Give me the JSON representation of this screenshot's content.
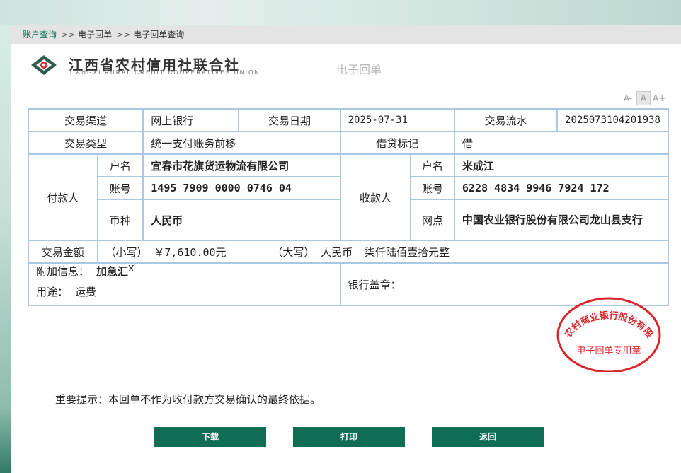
{
  "breadcrumb": [
    "账户查询",
    "电子回单",
    "电子回单查询"
  ],
  "bank": {
    "name_cn": "江西省农村信用社联合社",
    "name_en": "JIANGXI RURAL CREDIT COOPERATIVES UNION"
  },
  "doc_title": "电子回单",
  "font_controls": [
    "A-",
    "A",
    "A+"
  ],
  "receipt": {
    "channel_label": "交易渠道",
    "channel": "网上银行",
    "date_label": "交易日期",
    "date": "2025-07-31",
    "serial_label": "交易流水",
    "serial": "2025073104201938",
    "type_label": "交易类型",
    "type": "统一支付账务前移",
    "dc_label": "借贷标记",
    "dc": "借",
    "payer_label": "付款人",
    "payer_name_label": "户名",
    "payer_name": "宜春市花旗货运物流有限公司",
    "payer_acct_label": "账号",
    "payer_acct": "1495 7909 0000 0746 04",
    "payer_cur_label": "币种",
    "payer_cur": "人民币",
    "payee_label": "收款人",
    "payee_name_label": "户名",
    "payee_name": "米成江",
    "payee_acct_label": "账号",
    "payee_acct": "6228 4834 9946 7924 172",
    "payee_branch_label": "网点",
    "payee_branch": "中国农业银行股份有限公司龙山县支行",
    "amount_label": "交易金额",
    "small_label": "（小写）",
    "small": "￥7,610.00元",
    "big_label": "（大写）",
    "big_currency": "人民币",
    "big": "柒仟陆佰壹拾元整",
    "addinfo_label": "附加信息：",
    "addinfo": "加急汇",
    "purpose_label": "用途：",
    "purpose": "运费",
    "seal_label": "银行盖章："
  },
  "stamp": {
    "arc_text": "宜春农村商业银行股份有限公司",
    "bottom_text": "电子回单专用章",
    "color": "#d9252b"
  },
  "notice": "重要提示：本回单不作为收付款方交易确认的最终依据。",
  "buttons": {
    "download": "下载",
    "print": "打印",
    "back": "返回"
  },
  "colors": {
    "accent": "#0f6d55",
    "table_border": "#a9c8e8"
  }
}
